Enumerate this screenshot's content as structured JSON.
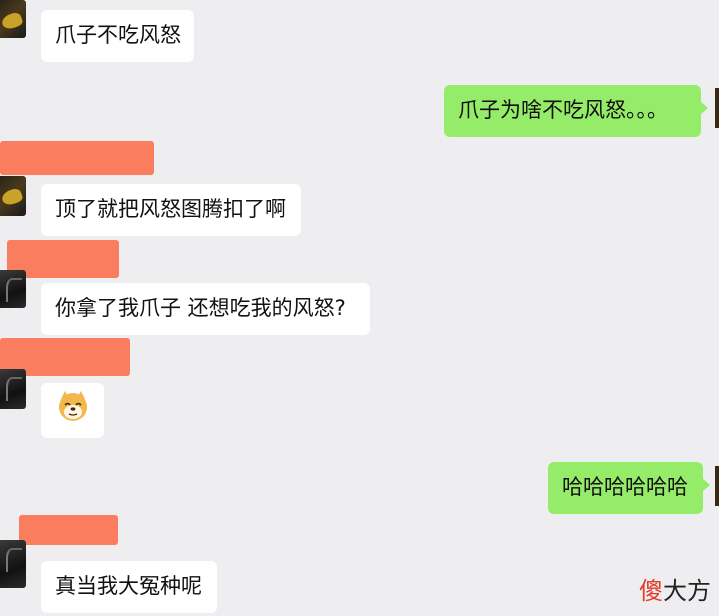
{
  "messages": [
    {
      "side": "left",
      "text": "爪子不吃风怒"
    },
    {
      "side": "right",
      "text": "爪子为啥不吃风怒。。。"
    },
    {
      "side": "left",
      "text": "顶了就把风怒图腾扣了啊"
    },
    {
      "side": "left",
      "text": "你拿了我爪子 还想吃我的风怒?"
    },
    {
      "side": "left",
      "emoji": "doge-emoji"
    },
    {
      "side": "right",
      "text": "哈哈哈哈哈哈"
    },
    {
      "side": "left",
      "text": "真当我大冤种呢"
    }
  ],
  "watermark": {
    "first_char": "傻",
    "rest": "大方"
  },
  "colors": {
    "background": "#eeeef0",
    "bubble_left": "#ffffff",
    "bubble_right": "#95ec69",
    "redaction": "#fb7d60"
  }
}
